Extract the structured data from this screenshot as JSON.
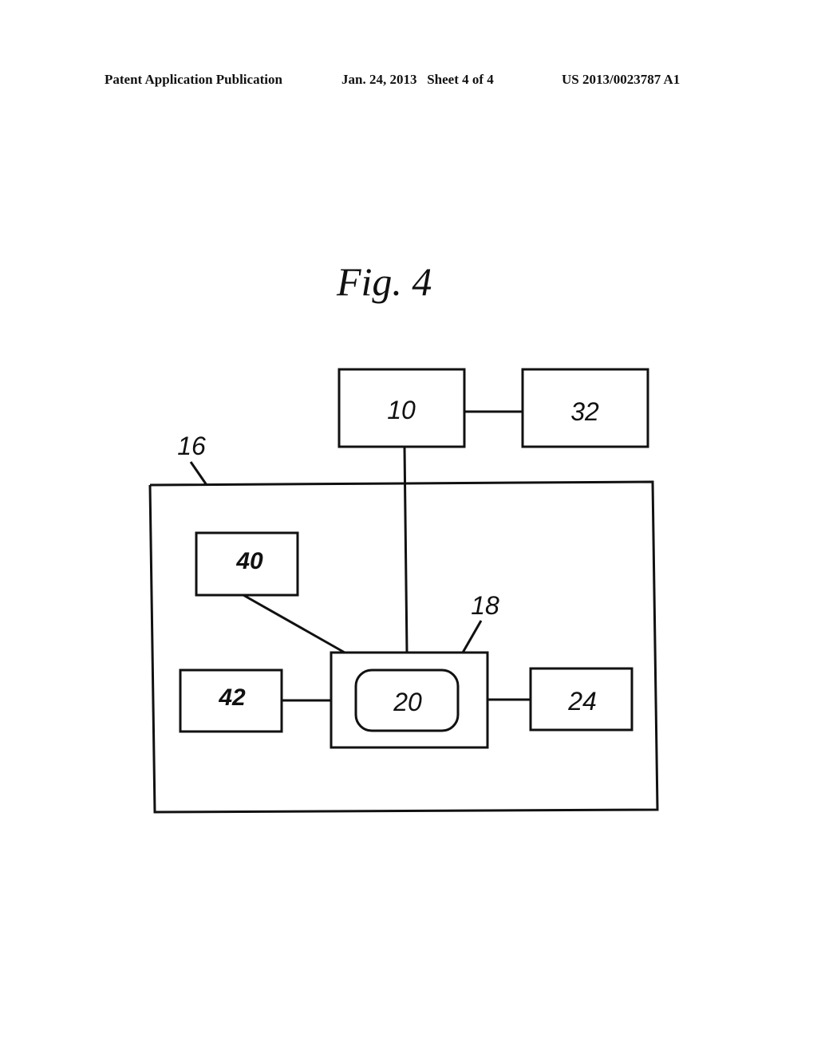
{
  "header": {
    "left": "Patent Application Publication",
    "middle": "Jan. 24, 2013   Sheet 4 of 4",
    "right": "US 2013/0023787 A1"
  },
  "figure": {
    "title": "Fig. 4",
    "blocks": [
      {
        "id": "block-10",
        "label": "10"
      },
      {
        "id": "block-32",
        "label": "32"
      },
      {
        "id": "block-40",
        "label": "40"
      },
      {
        "id": "block-42",
        "label": "42"
      },
      {
        "id": "block-18",
        "label": ""
      },
      {
        "id": "block-20",
        "label": "20"
      },
      {
        "id": "block-24",
        "label": "24"
      }
    ],
    "reference_labels": {
      "enclosure": "16",
      "housing": "18"
    },
    "connections": [
      [
        "10",
        "32"
      ],
      [
        "10",
        "18"
      ],
      [
        "40",
        "18"
      ],
      [
        "42",
        "18"
      ],
      [
        "18",
        "24"
      ]
    ]
  }
}
